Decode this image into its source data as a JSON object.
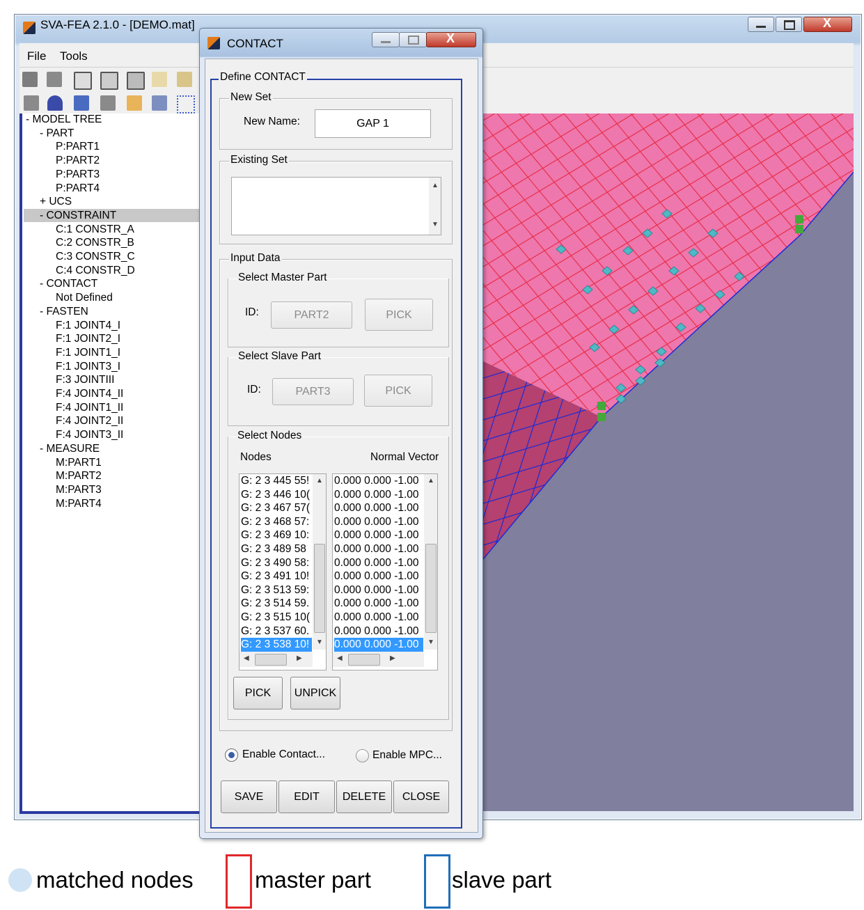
{
  "main_window": {
    "title": "SVA-FEA 2.1.0 - [DEMO.mat]",
    "menu": [
      "File",
      "Tools"
    ],
    "toolbar1_icons": [
      "new-icon",
      "open-icon",
      "mesh-icon",
      "mesh-refine-icon",
      "mesh-coarse-icon",
      "scale-x-icon",
      "scale-z-icon"
    ],
    "toolbar2_icons": [
      "select-icon",
      "pin-icon",
      "rotate-icon",
      "fill-icon",
      "align-icon",
      "measure-icon",
      "grid-icon"
    ]
  },
  "model_tree": [
    {
      "label": "- MODEL TREE",
      "level": 0
    },
    {
      "label": "- PART",
      "level": 1
    },
    {
      "label": "P:PART1",
      "level": 2
    },
    {
      "label": "P:PART2",
      "level": 2
    },
    {
      "label": "P:PART3",
      "level": 2
    },
    {
      "label": "P:PART4",
      "level": 2
    },
    {
      "label": "+ UCS",
      "level": 1
    },
    {
      "label": "- CONSTRAINT",
      "level": 1,
      "selected": true
    },
    {
      "label": "C:1 CONSTR_A",
      "level": 2
    },
    {
      "label": "C:2 CONSTR_B",
      "level": 2
    },
    {
      "label": "C:3 CONSTR_C",
      "level": 2
    },
    {
      "label": "C:4 CONSTR_D",
      "level": 2
    },
    {
      "label": "- CONTACT",
      "level": 1
    },
    {
      "label": "Not Defined",
      "level": 2
    },
    {
      "label": "- FASTEN",
      "level": 1
    },
    {
      "label": "F:1 JOINT4_I",
      "level": 2
    },
    {
      "label": "F:1 JOINT2_I",
      "level": 2
    },
    {
      "label": "F:1 JOINT1_I",
      "level": 2
    },
    {
      "label": "F:1 JOINT3_I",
      "level": 2
    },
    {
      "label": "F:3 JOINTIII",
      "level": 2
    },
    {
      "label": "F:4 JOINT4_II",
      "level": 2
    },
    {
      "label": "F:4 JOINT1_II",
      "level": 2
    },
    {
      "label": "F:4 JOINT2_II",
      "level": 2
    },
    {
      "label": "F:4 JOINT3_II",
      "level": 2
    },
    {
      "label": "- MEASURE",
      "level": 1
    },
    {
      "label": "M:PART1",
      "level": 2
    },
    {
      "label": "M:PART2",
      "level": 2
    },
    {
      "label": "M:PART3",
      "level": 2
    },
    {
      "label": "M:PART4",
      "level": 2
    }
  ],
  "dialog": {
    "title": "CONTACT",
    "define_frame": "Define CONTACT",
    "new_set": {
      "frame": "New Set",
      "label": "New Name:",
      "value": "GAP 1"
    },
    "existing_set": {
      "frame": "Existing Set"
    },
    "input_data": {
      "frame": "Input Data",
      "master": {
        "frame": "Select Master Part",
        "id_label": "ID:",
        "value": "PART2",
        "pick": "PICK"
      },
      "slave": {
        "frame": "Select Slave Part",
        "id_label": "ID:",
        "value": "PART3",
        "pick": "PICK"
      },
      "nodes": {
        "frame": "Select Nodes",
        "col_nodes": "Nodes",
        "col_normal": "Normal Vector",
        "node_rows": [
          "G: 2 3 445 55!",
          "G: 2 3 446 10(",
          "G: 2 3 467 57(",
          "G: 2 3 468 57:",
          "G: 2 3 469 10:",
          "G: 2 3 489 58",
          "G: 2 3 490 58:",
          "G: 2 3 491 10!",
          "G: 2 3 513 59:",
          "G: 2 3 514 59.",
          "G: 2 3 515 10(",
          "G: 2 3 537 60.",
          "G: 2 3 538 10!"
        ],
        "normal_rows": [
          "0.000 0.000 -1.00",
          "0.000 0.000 -1.00",
          "0.000 0.000 -1.00",
          "0.000 0.000 -1.00",
          "0.000 0.000 -1.00",
          "0.000 0.000 -1.00",
          "0.000 0.000 -1.00",
          "0.000 0.000 -1.00",
          "0.000 0.000 -1.00",
          "0.000 0.000 -1.00",
          "0.000 0.000 -1.00",
          "0.000 0.000 -1.00",
          "0.000 0.000 -1.00"
        ],
        "selected_index": 12,
        "pick": "PICK",
        "unpick": "UNPICK"
      }
    },
    "enable_contact": "Enable Contact...",
    "enable_mpc": "Enable MPC...",
    "contact_checked": true,
    "buttons": {
      "save": "SAVE",
      "edit": "EDIT",
      "delete": "DELETE",
      "close": "CLOSE"
    }
  },
  "legend": {
    "matched": "matched nodes",
    "master": "master part",
    "slave": "slave part",
    "colors": {
      "matched": "#cfe3f5",
      "master": "#e0282a",
      "slave": "#1f6fb8"
    }
  },
  "viewport_colors": {
    "master_fill": "#ee77ad",
    "slave_fill": "#807f9d",
    "master_lines": "#e8304a",
    "slave_lines": "#1c2bd6",
    "node": "#4fb9c6",
    "constraint": "#45a83a"
  }
}
